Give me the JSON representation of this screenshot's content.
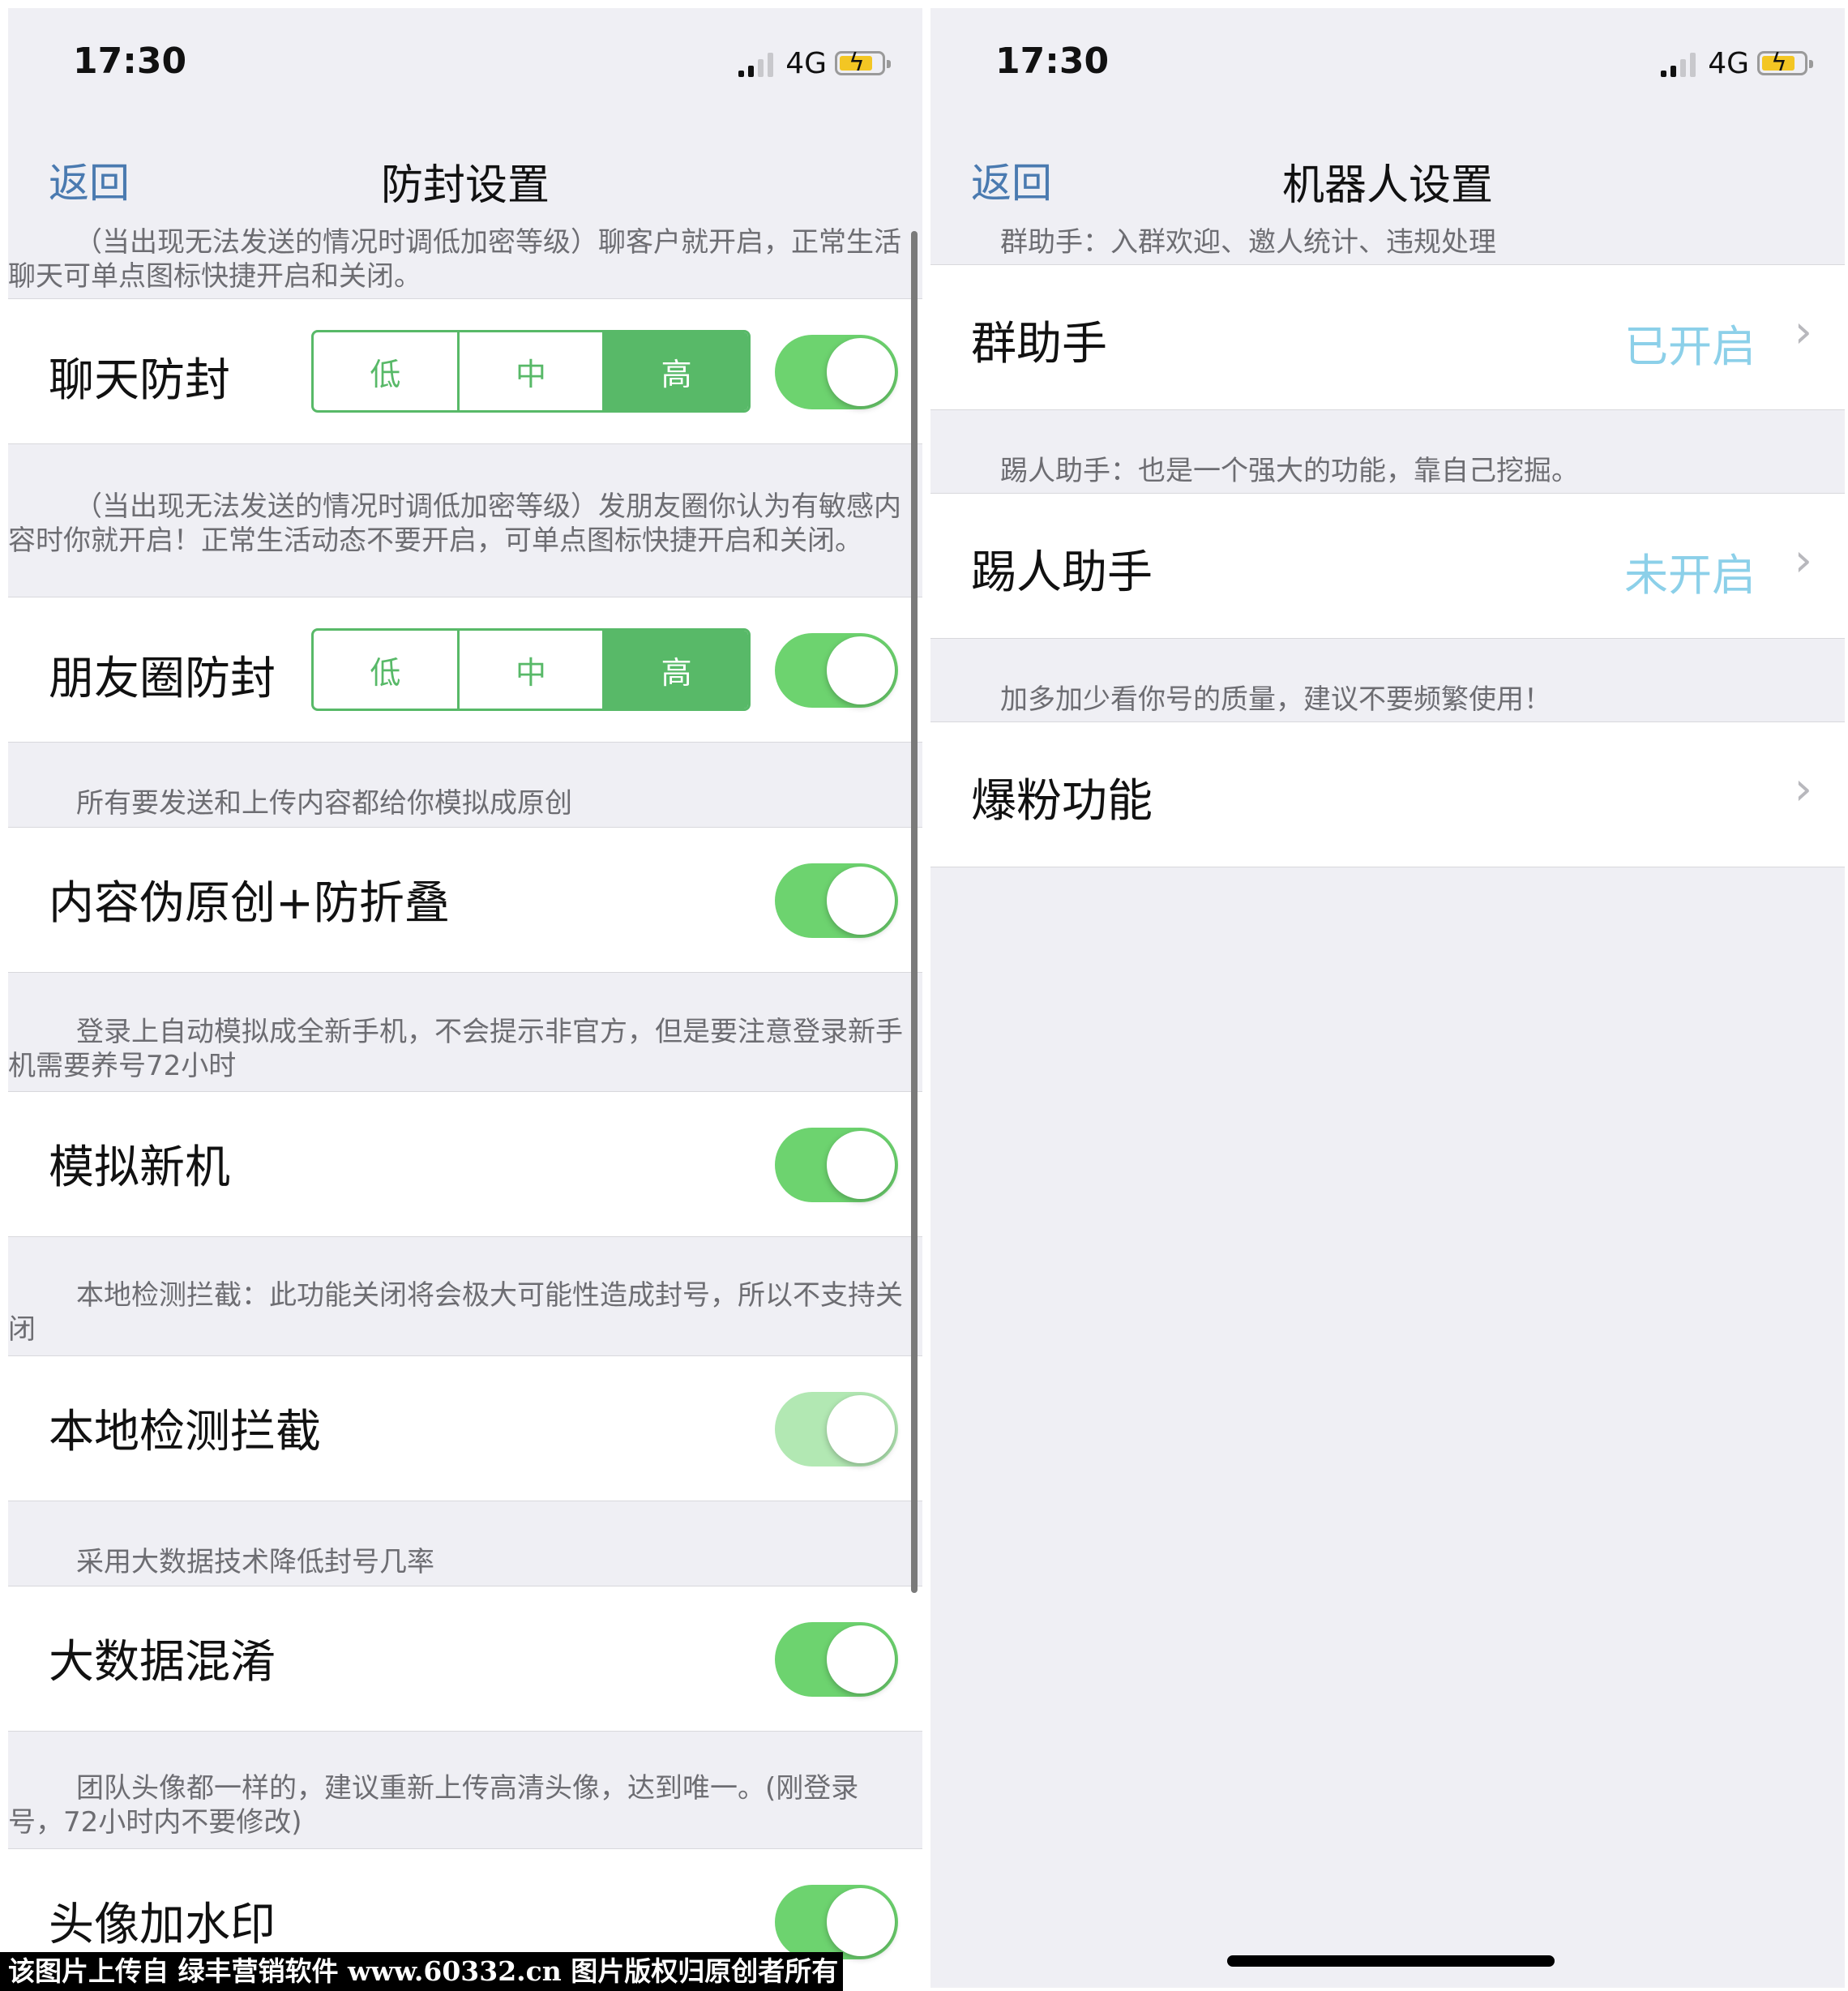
{
  "left": {
    "status": {
      "time": "17:30",
      "network": "4G"
    },
    "nav": {
      "back": "返回",
      "title": "防封设置"
    },
    "segment_labels": [
      "低",
      "中",
      "高"
    ],
    "sections": [
      {
        "note": "（当出现无法发送的情况时调低加密等级）聊客户就开启，正常生活聊天可单点图标快捷开启和关闭。",
        "label": "聊天防封",
        "level": "高",
        "enabled": true
      },
      {
        "note": "（当出现无法发送的情况时调低加密等级）发朋友圈你认为有敏感内容时你就开启！正常生活动态不要开启，可单点图标快捷开启和关闭。",
        "label": "朋友圈防封",
        "level": "高",
        "enabled": true
      },
      {
        "note": "所有要发送和上传内容都给你模拟成原创",
        "label": "内容伪原创+防折叠",
        "enabled": true
      },
      {
        "note": "登录上自动模拟成全新手机，不会提示非官方，但是要注意登录新手机需要养号72小时",
        "label": "模拟新机",
        "enabled": true
      },
      {
        "note": "本地检测拦截：此功能关闭将会极大可能性造成封号，所以不支持关闭",
        "label": "本地检测拦截",
        "enabled": true,
        "disabled": true
      },
      {
        "note": "采用大数据技术降低封号几率",
        "label": "大数据混淆",
        "enabled": true
      },
      {
        "note": "团队头像都一样的，建议重新上传高清头像，达到唯一。(刚登录号，72小时内不要修改)",
        "label": "头像加水印",
        "enabled": true
      }
    ]
  },
  "right": {
    "status": {
      "time": "17:30",
      "network": "4G"
    },
    "nav": {
      "back": "返回",
      "title": "机器人设置"
    },
    "rows": [
      {
        "note": "群助手：入群欢迎、邀人统计、违规处理",
        "label": "群助手",
        "value": "已开启"
      },
      {
        "note": "踢人助手：也是一个强大的功能，靠自己挖掘。",
        "label": "踢人助手",
        "value": "未开启"
      },
      {
        "note": "加多加少看你号的质量，建议不要频繁使用！",
        "label": "爆粉功能",
        "value": ""
      }
    ]
  },
  "watermark": "该图片上传自 绿丰营销软件 www.60332.cn 图片版权归原创者所有",
  "colors": {
    "toggle_on": "#6dd36f",
    "segment_green": "#58b968",
    "link_blue": "#4a7ab0",
    "value_blue": "#8cd0e9",
    "background": "#efeff4"
  }
}
